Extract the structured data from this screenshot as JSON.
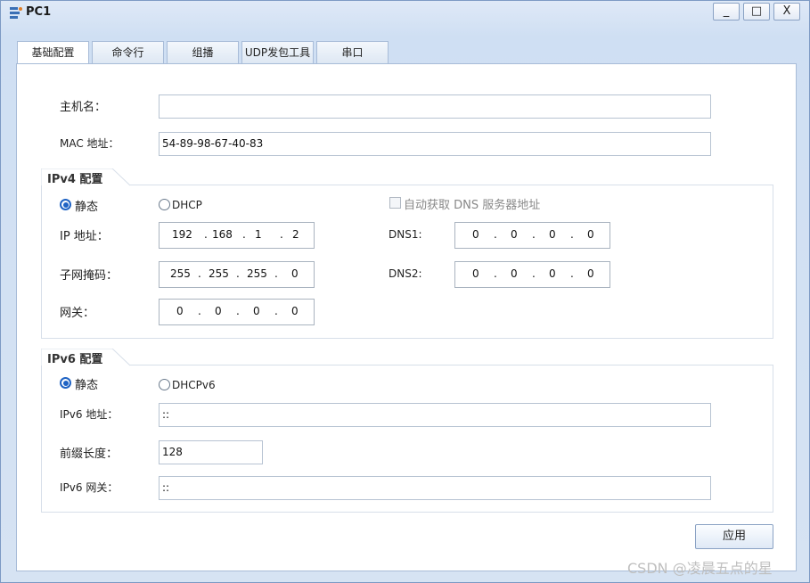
{
  "window": {
    "title": "PC1",
    "minimize_glyph": "_",
    "maximize_glyph": "□",
    "close_glyph": "X"
  },
  "tabs": [
    "基础配置",
    "命令行",
    "组播",
    "UDP发包工具",
    "串口"
  ],
  "basic": {
    "hostname_label": "主机名：",
    "hostname_value": "",
    "mac_label": "MAC 地址：",
    "mac_value": "54-89-98-67-40-83"
  },
  "ipv4": {
    "group_title": "IPv4 配置",
    "static_label": "静态",
    "dhcp_label": "DHCP",
    "auto_dns_label": "自动获取 DNS 服务器地址",
    "ip_label": "IP 地址：",
    "ip": [
      "192",
      "168",
      "1",
      "2"
    ],
    "mask_label": "子网掩码：",
    "mask": [
      "255",
      "255",
      "255",
      "0"
    ],
    "gateway_label": "网关：",
    "gateway": [
      "0",
      "0",
      "0",
      "0"
    ],
    "dns1_label": "DNS1:",
    "dns1": [
      "0",
      "0",
      "0",
      "0"
    ],
    "dns2_label": "DNS2:",
    "dns2": [
      "0",
      "0",
      "0",
      "0"
    ],
    "dot": "."
  },
  "ipv6": {
    "group_title": "IPv6 配置",
    "static_label": "静态",
    "dhcp_label": "DHCPv6",
    "addr_label": "IPv6 地址：",
    "addr_value": "::",
    "prefix_label": "前缀长度：",
    "prefix_value": "128",
    "gateway_label": "IPv6 网关：",
    "gateway_value": "::"
  },
  "apply_label": "应用",
  "watermark": "CSDN @凌晨五点的星"
}
